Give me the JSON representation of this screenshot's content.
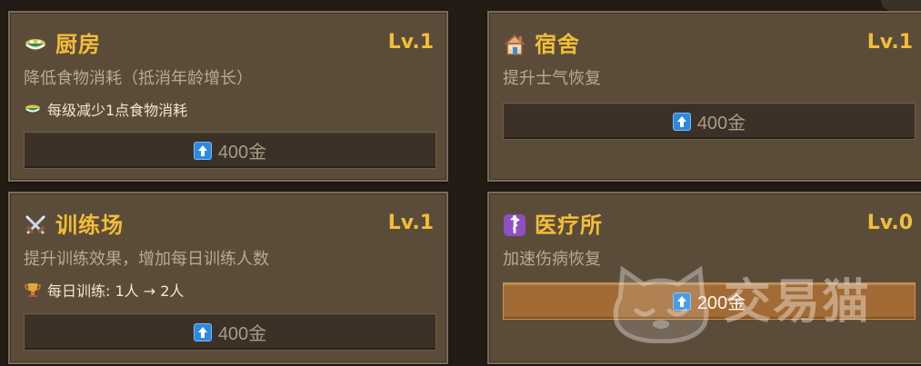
{
  "buildings": {
    "kitchen": {
      "title": "厨房",
      "level": "Lv.1",
      "description": "降低食物消耗（抵消年龄增长）",
      "effect": "每级减少1点食物消耗",
      "upgrade_cost": "400金",
      "icon": "bowl-icon",
      "effect_icon": "bowl-icon"
    },
    "dorm": {
      "title": "宿舍",
      "level": "Lv.1",
      "description": "提升士气恢复",
      "upgrade_cost": "400金",
      "icon": "house-icon"
    },
    "training": {
      "title": "训练场",
      "level": "Lv.1",
      "description": "提升训练效果，增加每日训练人数",
      "effect": "每日训练: 1人 → 2人",
      "upgrade_cost": "400金",
      "icon": "crossed-swords-icon",
      "effect_icon": "trophy-icon"
    },
    "medical": {
      "title": "医疗所",
      "level": "Lv.0",
      "description": "加速伤病恢复",
      "upgrade_cost": "200金",
      "icon": "medical-icon"
    }
  },
  "watermark": {
    "text": "交易猫"
  },
  "colors": {
    "background": "#231c16",
    "card": "#5b4c3a",
    "title": "#f3bd37",
    "button": "#3c3127",
    "active_button": "#a26a34",
    "upgrade_icon": "#2b8ae0"
  }
}
